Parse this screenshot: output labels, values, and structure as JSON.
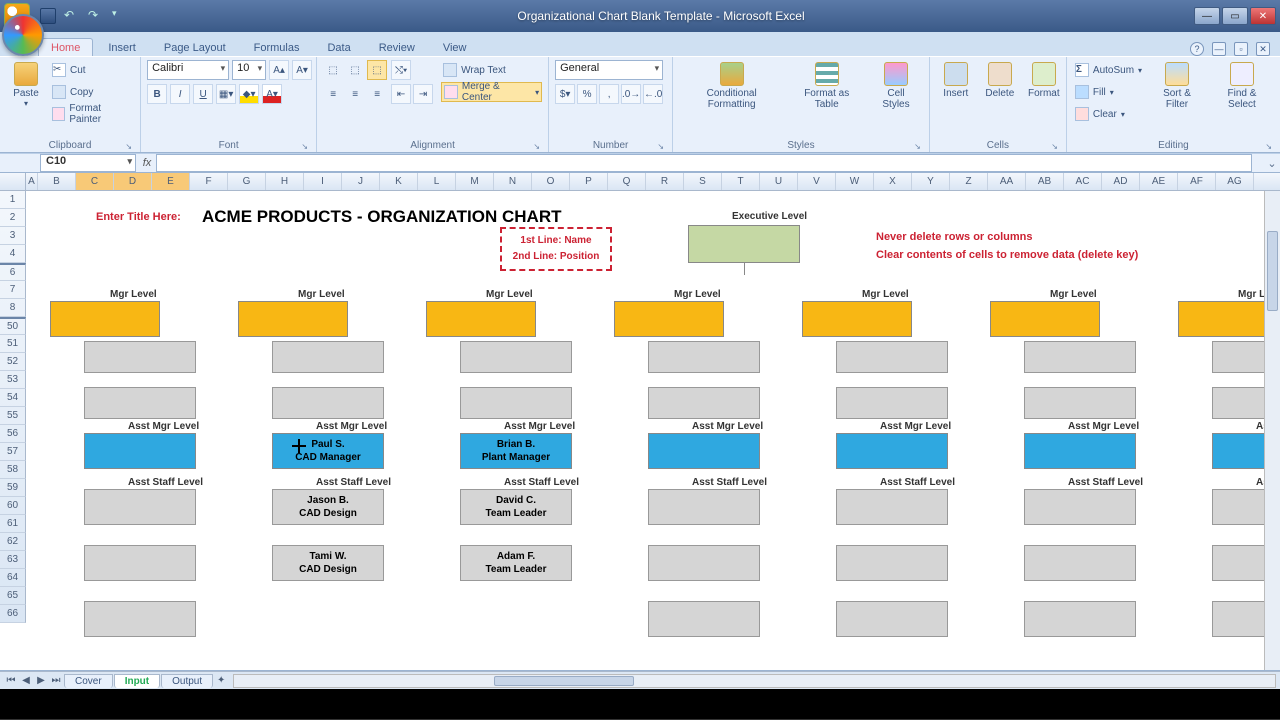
{
  "window": {
    "title": "Organizational Chart Blank Template - Microsoft Excel"
  },
  "ribbon_tabs": [
    "Home",
    "Insert",
    "Page Layout",
    "Formulas",
    "Data",
    "Review",
    "View"
  ],
  "active_tab": "Home",
  "clipboard": {
    "paste": "Paste",
    "cut": "Cut",
    "copy": "Copy",
    "fp": "Format Painter",
    "label": "Clipboard"
  },
  "font": {
    "name": "Calibri",
    "size": "10",
    "label": "Font",
    "bold": "B",
    "italic": "I",
    "underline": "U"
  },
  "alignment": {
    "wrap": "Wrap Text",
    "merge": "Merge & Center",
    "label": "Alignment"
  },
  "number": {
    "format": "General",
    "label": "Number",
    "pct": "%",
    "comma": ","
  },
  "styles": {
    "cf": "Conditional Formatting",
    "ft": "Format as Table",
    "cs": "Cell Styles",
    "label": "Styles"
  },
  "cells": {
    "ins": "Insert",
    "del": "Delete",
    "fmt": "Format",
    "label": "Cells"
  },
  "editing": {
    "sum": "AutoSum",
    "fill": "Fill",
    "clear": "Clear",
    "sort": "Sort & Filter",
    "find": "Find & Select",
    "label": "Editing"
  },
  "namebox": "C10",
  "columns": [
    "A",
    "B",
    "C",
    "D",
    "E",
    "F",
    "G",
    "H",
    "I",
    "J",
    "K",
    "L",
    "M",
    "N",
    "O",
    "P",
    "Q",
    "R",
    "S",
    "T",
    "U",
    "V",
    "W",
    "X",
    "Y",
    "Z",
    "AA",
    "AB",
    "AC",
    "AD",
    "AE",
    "AF",
    "AG"
  ],
  "rows_visible": [
    "1",
    "2",
    "3",
    "4",
    "6",
    "7",
    "8",
    "50",
    "51",
    "52",
    "53",
    "54",
    "55",
    "56",
    "57",
    "58",
    "59",
    "60",
    "61",
    "62",
    "63",
    "64",
    "65",
    "66"
  ],
  "content": {
    "title_prompt": "Enter Title Here:",
    "title": "ACME PRODUCTS - ORGANIZATION CHART",
    "legend1": "1st Line: Name",
    "legend2": "2nd Line: Position",
    "exec_label": "Executive Level",
    "mgr_label": "Mgr Level",
    "asst_mgr_label": "Asst Mgr Level",
    "asst_staff_label": "Asst Staff Level",
    "warn1": "Never delete rows or columns",
    "warn2": "Clear contents of cells to remove data (delete key)",
    "people": {
      "paul": {
        "n": "Paul S.",
        "p": "CAD Manager"
      },
      "brian": {
        "n": "Brian B.",
        "p": "Plant Manager"
      },
      "jason": {
        "n": "Jason B.",
        "p": "CAD Design"
      },
      "tami": {
        "n": "Tami W.",
        "p": "CAD Design"
      },
      "david": {
        "n": "David C.",
        "p": "Team Leader"
      },
      "adam": {
        "n": "Adam F.",
        "p": "Team Leader"
      }
    }
  },
  "sheet_tabs": [
    "Cover",
    "Input",
    "Output"
  ],
  "sigma": "Σ"
}
